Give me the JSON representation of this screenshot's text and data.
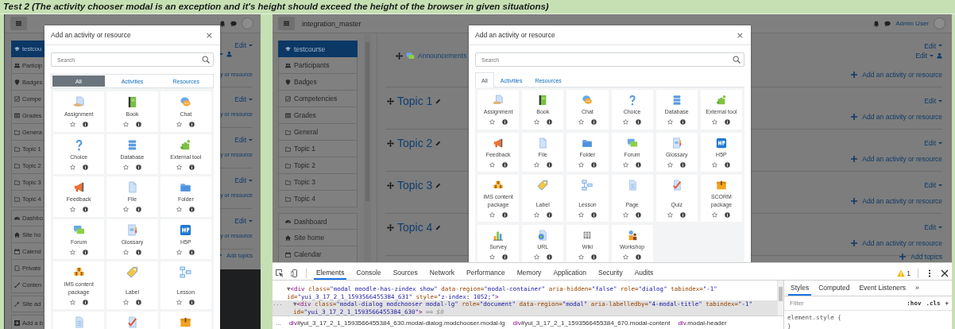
{
  "caption": "Test 2 (The activity chooser modal is an exception and it's height should exceed the height of the browser in given situations)",
  "screens": [
    {
      "kind": "narrow",
      "sidebar": [
        {
          "items": [
            {
              "label": "testcou",
              "selected": true
            },
            {
              "label": "Particip",
              "selected": false
            },
            {
              "label": "Badges",
              "selected": false
            },
            {
              "label": "Compe",
              "selected": false
            },
            {
              "label": "Grades",
              "selected": false
            },
            {
              "label": "Genera",
              "selected": false
            },
            {
              "label": "Topic 1",
              "selected": false
            },
            {
              "label": "Topic 2",
              "selected": false
            },
            {
              "label": "Topic 3",
              "selected": false
            },
            {
              "label": "Topic 4",
              "selected": false
            }
          ]
        },
        {
          "items": [
            {
              "label": "Dashbo",
              "selected": false
            },
            {
              "label": "Site ho",
              "selected": false
            },
            {
              "label": "Calend",
              "selected": false
            },
            {
              "label": "Private",
              "selected": false
            },
            {
              "label": "Conten",
              "selected": false
            }
          ]
        },
        {
          "items": [
            {
              "label": "Site ad",
              "selected": false
            }
          ]
        },
        {
          "items": [
            {
              "label": "Add a b",
              "selected": false
            }
          ]
        }
      ],
      "sections": [
        {
          "edit": "Edit",
          "activity": {
            "kind": "menu-only"
          },
          "add": "y or resource"
        },
        {
          "edit": "Edit",
          "add": "y or resource"
        },
        {
          "edit": "Edit",
          "add": "y or resource"
        },
        {
          "edit": "Edit",
          "add": "y or resource"
        },
        {
          "edit": "Edit",
          "add": "y or resource"
        }
      ],
      "add_topics": "Add topics",
      "modal": {
        "title": "Add an activity or resource",
        "close": "×",
        "search": {
          "placeholder": "Search"
        },
        "tabs": [
          {
            "label": "All",
            "selected": true
          },
          {
            "label": "Activities",
            "selected": false
          },
          {
            "label": "Resources",
            "selected": false
          }
        ],
        "items": [
          {
            "kind": "full",
            "label": "Assignment"
          },
          {
            "kind": "full",
            "label": "Book"
          },
          {
            "kind": "full",
            "label": "Chat"
          },
          {
            "kind": "full",
            "label": "Choice"
          },
          {
            "kind": "full",
            "label": "Database"
          },
          {
            "kind": "full",
            "label": "External tool"
          },
          {
            "kind": "full",
            "label": "Feedback"
          },
          {
            "kind": "full",
            "label": "File"
          },
          {
            "kind": "full",
            "label": "Folder"
          },
          {
            "kind": "full",
            "label": "Forum"
          },
          {
            "kind": "full",
            "label": "Glossary"
          },
          {
            "kind": "full",
            "label": "H5P"
          },
          {
            "kind": "full",
            "label": "IMS content package"
          },
          {
            "kind": "full",
            "label": "Label"
          },
          {
            "kind": "full",
            "label": "Lesson"
          },
          {
            "kind": "partial"
          },
          {
            "kind": "partial"
          },
          {
            "kind": "partial"
          }
        ]
      }
    },
    {
      "kind": "wide",
      "navbar": {
        "site_name": "integration_master",
        "user": "Admin User"
      },
      "sidebar": [
        {
          "items": [
            {
              "label": "testcourse",
              "selected": true
            },
            {
              "label": "Participants",
              "selected": false
            },
            {
              "label": "Badges",
              "selected": false
            },
            {
              "label": "Competencies",
              "selected": false
            },
            {
              "label": "Grades",
              "selected": false
            },
            {
              "label": "General",
              "selected": false
            },
            {
              "label": "Topic 1",
              "selected": false
            },
            {
              "label": "Topic 2",
              "selected": false
            },
            {
              "label": "Topic 3",
              "selected": false
            },
            {
              "label": "Topic 4",
              "selected": false
            }
          ]
        },
        {
          "items": [
            {
              "label": "Dashboard",
              "selected": false
            },
            {
              "label": "Site home",
              "selected": false
            },
            {
              "label": "Calendar",
              "selected": false
            }
          ]
        }
      ],
      "sections": [
        {
          "edit": "Edit",
          "activity": {
            "kind": "full",
            "name": "Announcements",
            "edit": "Edit"
          },
          "add": "Add an activity or resource"
        },
        {
          "title": "Topic 1",
          "edit": "Edit",
          "add": "Add an activity or resource"
        },
        {
          "title": "Topic 2",
          "edit": "Edit",
          "add": "Add an activity or resource"
        },
        {
          "title": "Topic 3",
          "edit": "Edit",
          "add": "Add an activity or resource"
        },
        {
          "title": "Topic 4",
          "edit": "Edit",
          "add": "Add an activity or resource"
        }
      ],
      "add_topics": "Add topics",
      "modal": {
        "title": "Add an activity or resource",
        "close": "×",
        "search": {
          "placeholder": "Search"
        },
        "tabs": [
          {
            "label": "All",
            "selected": true
          },
          {
            "label": "Activities",
            "selected": false
          },
          {
            "label": "Resources",
            "selected": false
          }
        ],
        "items": [
          {
            "label": "Assignment"
          },
          {
            "label": "Book"
          },
          {
            "label": "Chat"
          },
          {
            "label": "Choice"
          },
          {
            "label": "Database"
          },
          {
            "label": "External tool"
          },
          {
            "label": "Feedback"
          },
          {
            "label": "File"
          },
          {
            "label": "Folder"
          },
          {
            "label": "Forum"
          },
          {
            "label": "Glossary"
          },
          {
            "label": "H5P"
          },
          {
            "label": "IMS content package"
          },
          {
            "label": "Label"
          },
          {
            "label": "Lesson"
          },
          {
            "label": "Page"
          },
          {
            "label": "Quiz"
          },
          {
            "label": "SCORM package"
          },
          {
            "label": "Survey"
          },
          {
            "label": "URL"
          },
          {
            "label": "Wiki"
          },
          {
            "label": "Workshop"
          }
        ]
      },
      "devtools": {
        "tabs": [
          {
            "label": "Elements",
            "selected": true
          },
          {
            "label": "Console",
            "selected": false
          },
          {
            "label": "Sources",
            "selected": false
          },
          {
            "label": "Network",
            "selected": false
          },
          {
            "label": "Performance",
            "selected": false
          },
          {
            "label": "Memory",
            "selected": false
          },
          {
            "label": "Application",
            "selected": false
          },
          {
            "label": "Security",
            "selected": false
          },
          {
            "label": "Audits",
            "selected": false
          }
        ],
        "warning_count": "1",
        "code": [
          {
            "selected": false,
            "tokens": [
              {
                "kind": "arrow",
                "text": "▼"
              },
              {
                "kind": "tag",
                "text": "<div"
              },
              {
                "kind": "attr",
                "text": " class="
              },
              {
                "kind": "value",
                "text": "\"modal moodle-has-zindex show\""
              },
              {
                "kind": "attr",
                "text": " data-region="
              },
              {
                "kind": "value",
                "text": "\"modal-container\""
              },
              {
                "kind": "attr",
                "text": " aria-hidden="
              },
              {
                "kind": "value",
                "text": "\"false\""
              },
              {
                "kind": "attr",
                "text": " role="
              },
              {
                "kind": "value",
                "text": "\"dialog\""
              },
              {
                "kind": "attr",
                "text": " tabindex="
              },
              {
                "kind": "value",
                "text": "\"-1\""
              },
              {
                "kind": "attr",
                "text": " id="
              },
              {
                "kind": "value",
                "text": "\"yui_3_17_2_1_1593566455384_631\""
              },
              {
                "kind": "attr",
                "text": " style="
              },
              {
                "kind": "value",
                "text": "\"z-index: 1052;\""
              },
              {
                "kind": "tag",
                "text": ">"
              }
            ],
            "children": [
              {
                "selected": true,
                "gutter": "...",
                "tokens": [
                  {
                    "kind": "arrow",
                    "text": "▼"
                  },
                  {
                    "kind": "tag",
                    "text": "<div"
                  },
                  {
                    "kind": "attr",
                    "text": " class="
                  },
                  {
                    "kind": "value",
                    "text": "\"modal-dialog modchooser modal-lg\""
                  },
                  {
                    "kind": "attr",
                    "text": " role="
                  },
                  {
                    "kind": "value",
                    "text": "\"document\""
                  },
                  {
                    "kind": "attr",
                    "text": " data-region="
                  },
                  {
                    "kind": "value",
                    "text": "\"modal\""
                  },
                  {
                    "kind": "attr",
                    "text": " aria-labelledby="
                  },
                  {
                    "kind": "value",
                    "text": "\"4-modal-title\""
                  },
                  {
                    "kind": "attr",
                    "text": " tabindex="
                  },
                  {
                    "kind": "value",
                    "text": "\"-1\""
                  },
                  {
                    "kind": "attr",
                    "text": " id="
                  },
                  {
                    "kind": "value",
                    "text": "\"yui_3_17_2_1_1593566455384_630\""
                  },
                  {
                    "kind": "tag",
                    "text": ">"
                  },
                  {
                    "kind": "note",
                    "text": " == $0"
                  }
                ]
              }
            ]
          }
        ],
        "breadcrumbs": [
          {
            "kind": "more",
            "text": "..."
          },
          {
            "kind": "crumb",
            "tag": "div",
            "rest": "#yui_3_17_2_1_1593566455384_630.modal-dialog.modchooser.modal-lg"
          },
          {
            "kind": "crumb",
            "tag": "div",
            "rest": "#yui_3_17_2_1_1593566455384_670.modal-content"
          },
          {
            "kind": "crumb",
            "tag": "div",
            "rest": ".modal-header"
          }
        ],
        "styles_tabs": [
          {
            "label": "Styles",
            "selected": true
          },
          {
            "label": "Computed",
            "selected": false
          },
          {
            "label": "Event Listeners",
            "selected": false
          },
          {
            "label": "»",
            "selected": false
          }
        ],
        "filter": {
          "placeholder": "Filter"
        },
        "filter_buttons": [
          ":hov",
          ".cls",
          "+"
        ],
        "rules": [
          "element.style {",
          "}"
        ]
      }
    }
  ]
}
